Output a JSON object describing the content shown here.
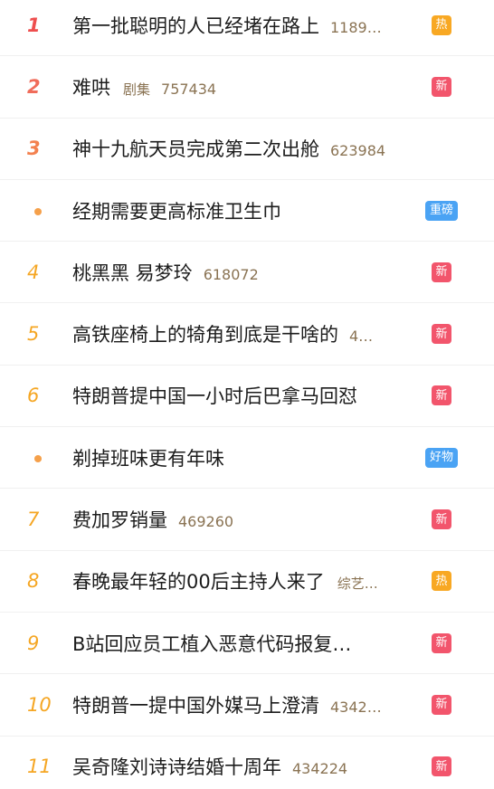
{
  "colors": {
    "rank_top": "#ee4e4e",
    "rank_other": "#f5a623",
    "badge_hot": "#f8a823",
    "badge_new": "#f2556c",
    "badge_blue": "#4aa3f4",
    "meta_text": "#8a7353"
  },
  "items": [
    {
      "rank": "1",
      "title": "第一批聪明的人已经堵在路上",
      "tag": "",
      "count": "1189…",
      "badge": "热",
      "badge_type": "hot"
    },
    {
      "rank": "2",
      "title": "难哄",
      "tag": "剧集",
      "count": "757434",
      "badge": "新",
      "badge_type": "new"
    },
    {
      "rank": "3",
      "title": "神十九航天员完成第二次出舱",
      "tag": "",
      "count": "623984",
      "badge": "",
      "badge_type": ""
    },
    {
      "rank": "",
      "title": "经期需要更高标准卫生巾",
      "tag": "",
      "count": "",
      "badge": "重磅",
      "badge_type": "heavy"
    },
    {
      "rank": "4",
      "title": "桃黑黑 易梦玲",
      "tag": "",
      "count": "618072",
      "badge": "新",
      "badge_type": "new"
    },
    {
      "rank": "5",
      "title": "高铁座椅上的犄角到底是干啥的",
      "tag": "",
      "count": "4…",
      "badge": "新",
      "badge_type": "new"
    },
    {
      "rank": "6",
      "title": "特朗普提中国一小时后巴拿马回怼",
      "tag": "",
      "count": "",
      "badge": "新",
      "badge_type": "new"
    },
    {
      "rank": "",
      "title": "剃掉班味更有年味",
      "tag": "",
      "count": "",
      "badge": "好物",
      "badge_type": "good"
    },
    {
      "rank": "7",
      "title": "费加罗销量",
      "tag": "",
      "count": "469260",
      "badge": "新",
      "badge_type": "new"
    },
    {
      "rank": "8",
      "title": "春晚最年轻的00后主持人来了",
      "tag": "综艺…",
      "count": "",
      "badge": "热",
      "badge_type": "hot"
    },
    {
      "rank": "9",
      "title": "B站回应员工植入恶意代码报复…",
      "tag": "",
      "count": "",
      "badge": "新",
      "badge_type": "new"
    },
    {
      "rank": "10",
      "title": "特朗普一提中国外媒马上澄清",
      "tag": "",
      "count": "4342…",
      "badge": "新",
      "badge_type": "new"
    },
    {
      "rank": "11",
      "title": "吴奇隆刘诗诗结婚十周年",
      "tag": "",
      "count": "434224",
      "badge": "新",
      "badge_type": "new"
    }
  ]
}
